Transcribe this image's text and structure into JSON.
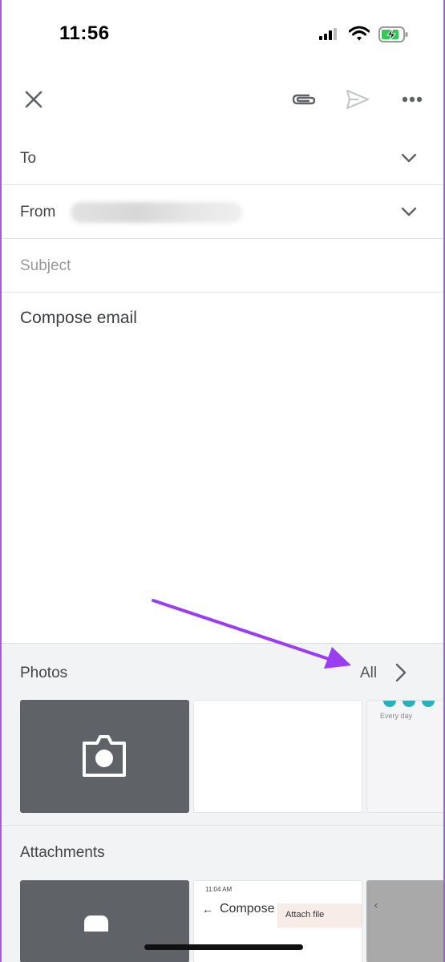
{
  "status_bar": {
    "time": "11:56"
  },
  "compose": {
    "to_label": "To",
    "from_label": "From",
    "subject_placeholder": "Subject",
    "body_placeholder": "Compose email"
  },
  "photos": {
    "title": "Photos",
    "all_label": "All",
    "thumb_caption": "Every day"
  },
  "attachments": {
    "title": "Attachments",
    "thumb_status": "11:04 AM",
    "thumb_title": "Compose",
    "thumb_attach": "Attach file"
  },
  "colors": {
    "accent_arrow": "#9b3df0",
    "tile_dark": "#5f6368",
    "teal": "#2ab0bd"
  }
}
